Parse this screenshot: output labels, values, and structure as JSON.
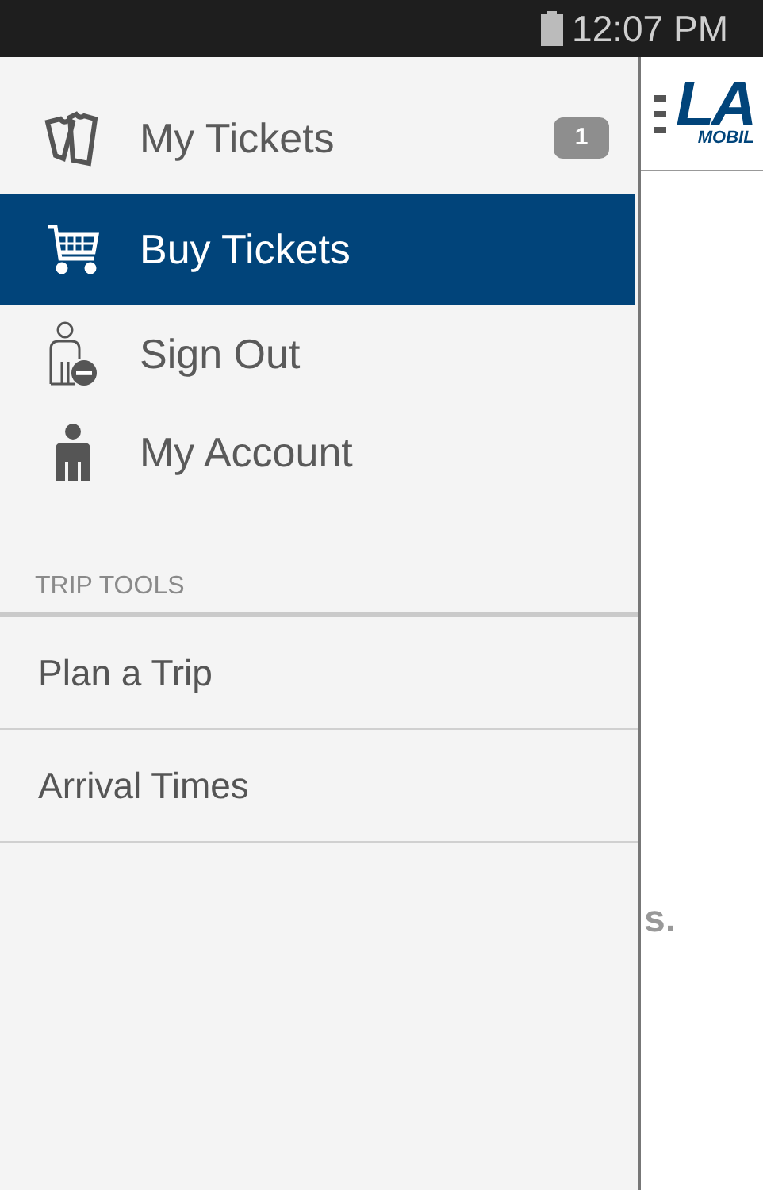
{
  "status_bar": {
    "time": "12:07 PM"
  },
  "drawer": {
    "items": [
      {
        "label": "My Tickets",
        "selected": false,
        "badge": "1"
      },
      {
        "label": "Buy Tickets",
        "selected": true
      },
      {
        "label": "Sign Out",
        "selected": false
      },
      {
        "label": "My Account",
        "selected": false
      }
    ],
    "section": {
      "title": "TRIP TOOLS",
      "items": [
        {
          "label": "Plan a Trip"
        },
        {
          "label": "Arrival Times"
        }
      ]
    }
  },
  "background": {
    "logo": "LA",
    "logo_subtitle": "MOBIL",
    "text_fragment": "s."
  }
}
